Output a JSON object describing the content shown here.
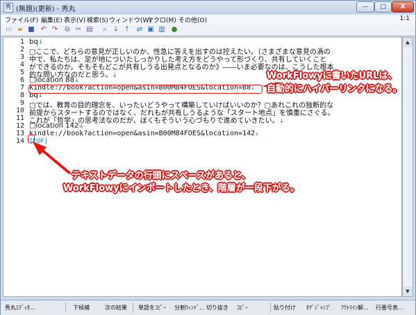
{
  "window": {
    "title": "(無題)(更新) - 秀丸",
    "app_icon": "秀",
    "minimize_label": "—",
    "maximize_label": "□",
    "close_label": "X"
  },
  "menu": {
    "items": [
      "ファイル(F)",
      "編集(E)",
      "表示(V)",
      "検索(S)",
      "ウィンドウ(W)",
      "マクロ(M)",
      "その他(O)"
    ],
    "position": "1:1"
  },
  "toolbar": {
    "icons": [
      "new-file-icon",
      "open-file-icon",
      "save-icon",
      "undo-icon",
      "redo-icon",
      "copy-icon",
      "cut-icon",
      "paste-icon",
      "search-icon",
      "search-down-icon",
      "search-up-icon",
      "replace-icon",
      "grep-icon",
      "window-icon",
      "help-icon"
    ]
  },
  "editor": {
    "line_numbers": [
      "1",
      "2",
      "3",
      "4",
      "5",
      "6",
      "7",
      "8",
      "9",
      "10",
      "11",
      "12",
      "13",
      "14"
    ],
    "lines": [
      "bq",
      "□ここで、どちらの意見が正しいのか、性急に答えを出すのは控えたい。（さまざまな意見の渦の",
      "ができるのか。そもそもどこが共有しうる出発点となるのか》――いま必要なのは、こうした根本",
      "的な問い方なのだと思う。",
      "□location 88",
      " kindle://book?action=open&asin=B00M84FOES&location=88",
      "bq",
      "□では、教育の目的理念を、いったいどうやって構築していけばいいのか？□あれこれの独断的な",
      "前提からスタートするのではなく、だれもが共有しうるような「スタート地点」を慎重にさぐる。",
      "これが「哲学」の思考法なのだが、ぼくもそういう心づもりで進めていきたい。",
      "□location 142",
      " kindle://book?action=open&asin=B00M84FOES&location=142",
      "[EOF]"
    ],
    "line2_middle": "中で、私たちは、足が地についたしっかりした考え方をどうやって形づくり、共有していくこと"
  },
  "annotations": {
    "url_note_line1": "WorkFlowyに書いたURLは、",
    "url_note_line2": "自動的にハイパーリンクになる。",
    "space_note_line1": "テキストデータの行頭にスペースがあると、",
    "space_note_line2": "WorkFlowyにインポートしたとき、階層が一段下がる。",
    "accent_color": "#e81717"
  },
  "statusbar": {
    "items": [
      "秀丸ｴﾃﾞｨﾀ...",
      "下候補",
      "次の結果",
      "単語をｺﾋﾟｰ",
      "分割ｳｨﾝﾄﾞ...",
      "切り抜き",
      "ｺﾋﾟｰ",
      "貼り付け",
      "ﾀｸﾞｼﾞｬﾝﾌﾟ",
      "ｱｳﾄﾗｲﾝ解...",
      "行番号表..."
    ]
  }
}
